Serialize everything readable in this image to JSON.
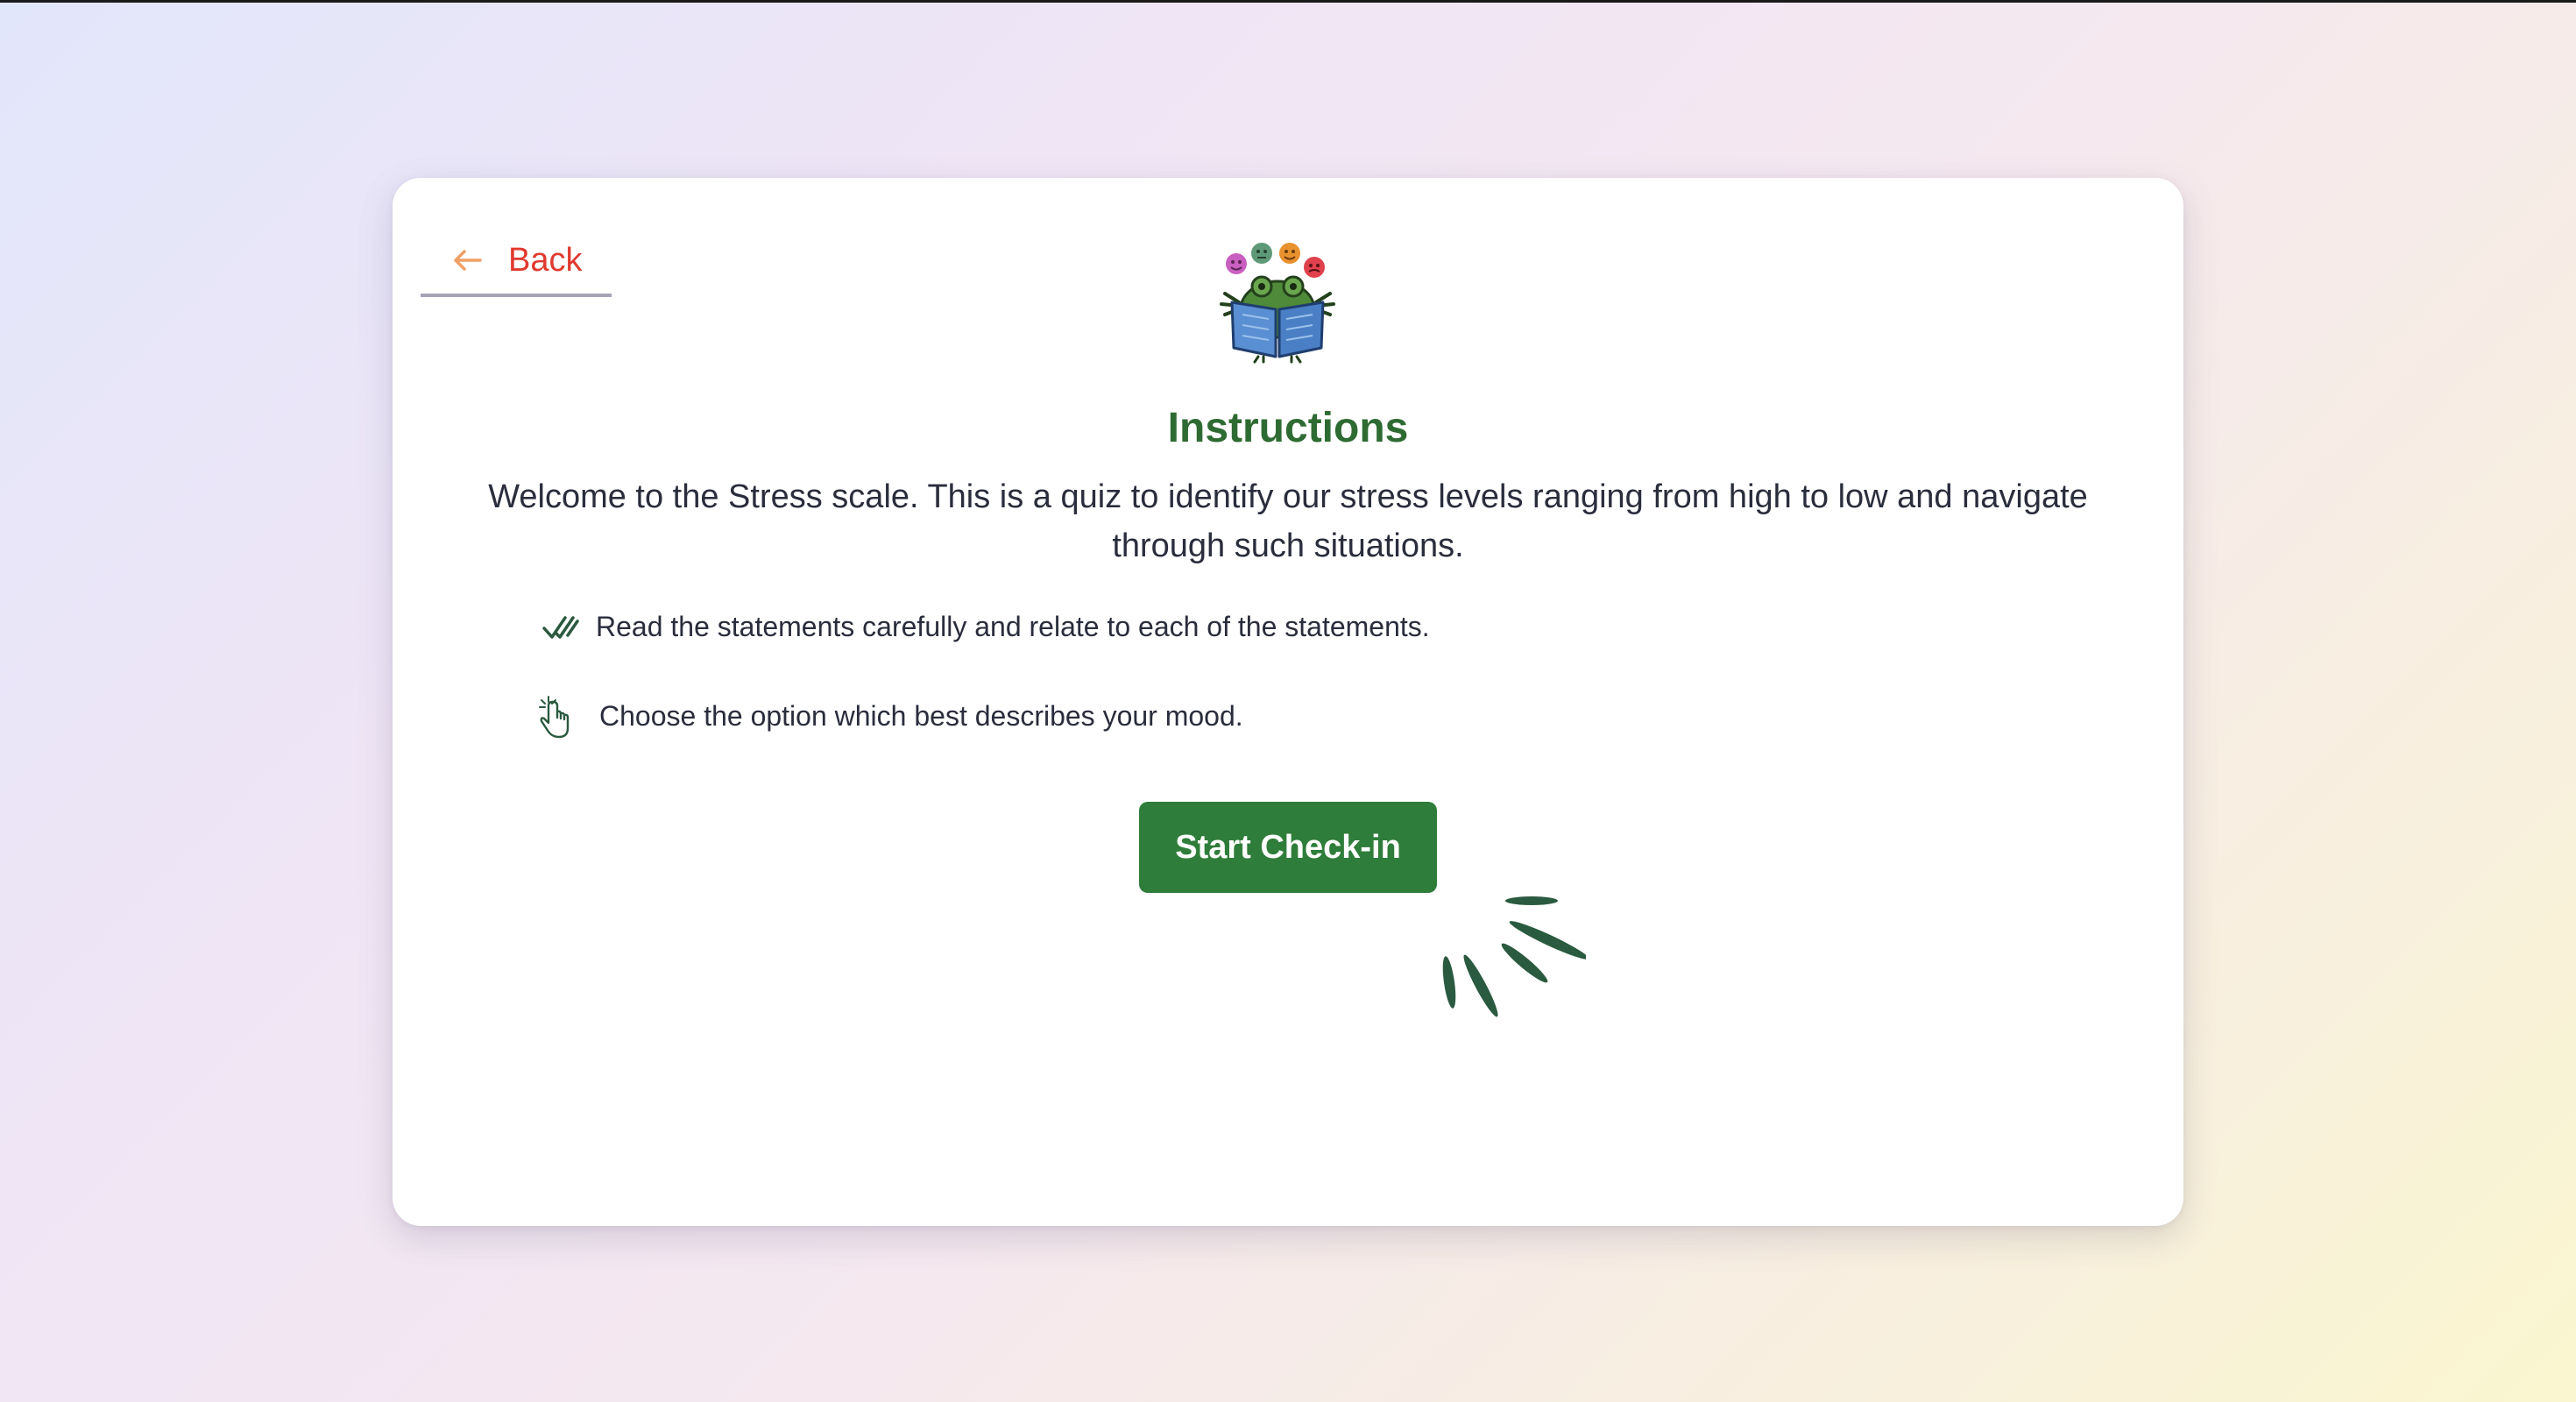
{
  "back": {
    "label": "Back",
    "icon": "arrow-left-icon",
    "color": "#e03a2f",
    "arrow_color": "#f0a066"
  },
  "mascot": {
    "icon": "frog-reading-book-icon"
  },
  "title": "Instructions",
  "intro": "Welcome to the Stress scale. This is a quiz to identify our stress levels ranging from high to low and navigate through such situations.",
  "instructions": [
    {
      "icon": "double-check-icon",
      "text": "Read the statements carefully and relate to each of the statements."
    },
    {
      "icon": "tap-hand-icon",
      "text": "Choose the option which best describes your mood."
    }
  ],
  "start_button": {
    "label": "Start Check-in",
    "color": "#2f7d3a"
  },
  "loading": {
    "icon": "spinner-icon",
    "color": "#2a5a3f"
  },
  "colors": {
    "title": "#2e6b32",
    "text": "#2a2d3c",
    "card": "#ffffff"
  }
}
